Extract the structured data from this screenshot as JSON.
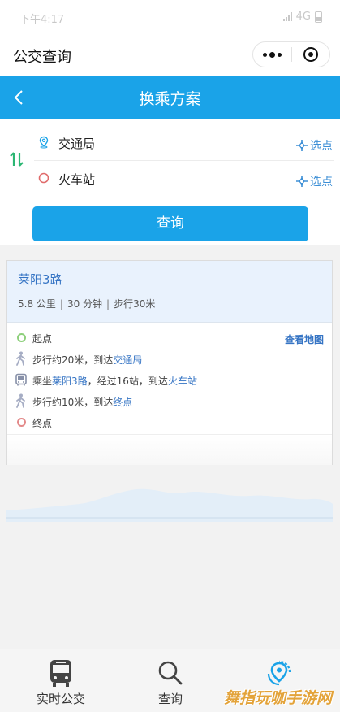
{
  "status_bar": {
    "time": "下午4:17",
    "network": "4G"
  },
  "app_header": {
    "title": "公交查询"
  },
  "nav": {
    "title": "换乘方案"
  },
  "search": {
    "from": "交通局",
    "to": "火车站",
    "pick_label": "选点",
    "query_button": "查询"
  },
  "route": {
    "name": "莱阳3路",
    "distance": "5.8 公里",
    "separator": "|",
    "duration": "30 分钟",
    "walk": "步行30米",
    "map_link": "查看地图",
    "steps": [
      {
        "icon": "start-dot-icon",
        "pre": "起点",
        "link": "",
        "post": ""
      },
      {
        "icon": "walk-icon",
        "pre": "步行约20米，到达",
        "link": "交通局",
        "post": ""
      },
      {
        "icon": "bus-icon",
        "pre": "乘坐",
        "link": "莱阳3路",
        "mid": "，经过16站，到达",
        "link2": "火车站"
      },
      {
        "icon": "walk-icon",
        "pre": "步行约10米，到达",
        "link": "终点",
        "post": ""
      },
      {
        "icon": "end-dot-icon",
        "pre": "终点",
        "link": "",
        "post": ""
      }
    ]
  },
  "tabbar": {
    "items": [
      {
        "label": "实时公交",
        "icon": "bus-icon"
      },
      {
        "label": "查询",
        "icon": "search-icon"
      },
      {
        "label": "",
        "icon": "location-refresh-icon",
        "active": true
      }
    ]
  },
  "watermark": "舞指玩咖手游网",
  "colors": {
    "primary": "#1aa3e8",
    "link": "#3574c4",
    "start": "#8ed07c",
    "end": "#e38a8a"
  }
}
